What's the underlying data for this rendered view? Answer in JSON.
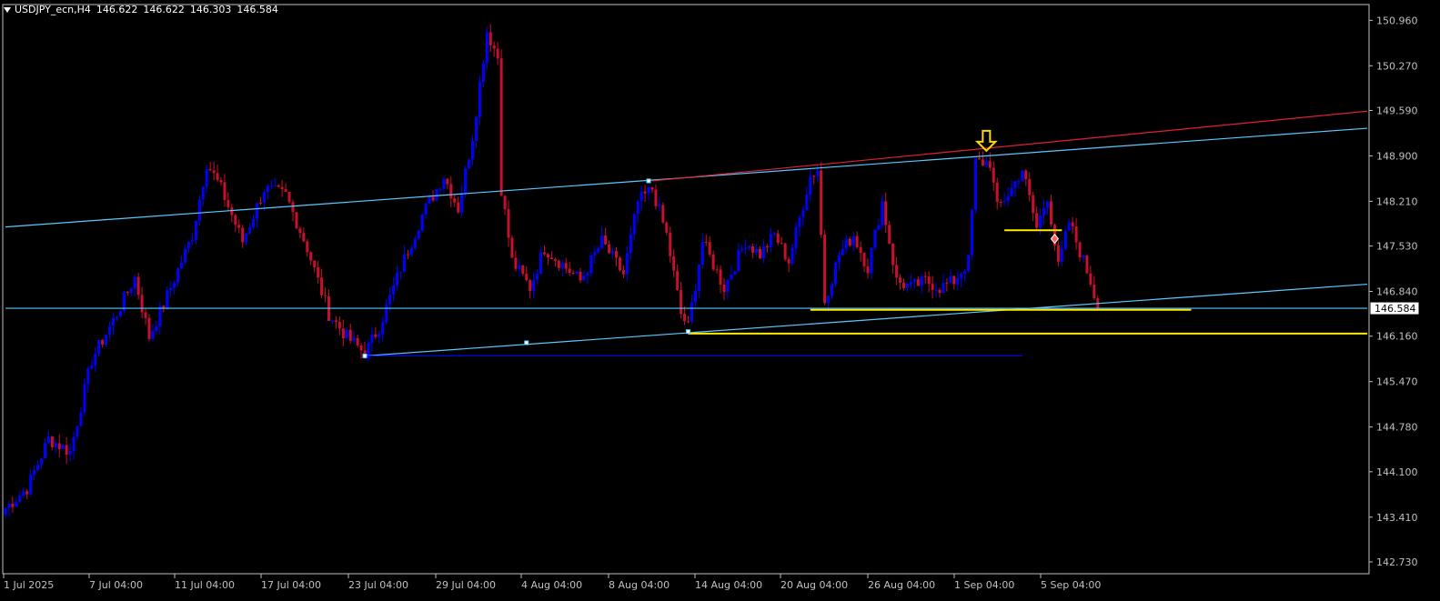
{
  "header": {
    "symbol": "USDJPY_ecn,H4",
    "open": "146.622",
    "high": "146.622",
    "low": "146.303",
    "close": "146.584"
  },
  "colors": {
    "background": "#000000",
    "axis": "#c0c0c0",
    "bull_candle": "#0000ff",
    "bear_candle": "#c8102e",
    "trendline_cyan": "#5bc8ff",
    "trendline_red": "#e0203a",
    "support_yellow": "#ffea00",
    "support_blue": "#0000ff",
    "arrow": "#ffd700"
  },
  "chart_data": {
    "type": "candlestick",
    "timeframe": "H4",
    "ylim": [
      142.55,
      151.2
    ],
    "yticks": [
      "150.960",
      "150.270",
      "149.590",
      "148.900",
      "148.210",
      "147.530",
      "146.840",
      "146.160",
      "145.470",
      "144.780",
      "144.100",
      "143.410",
      "142.730"
    ],
    "xticks": [
      "1 Jul 2025",
      "7 Jul 04:00",
      "11 Jul 04:00",
      "17 Jul 04:00",
      "23 Jul 04:00",
      "29 Jul 04:00",
      "4 Aug 04:00",
      "8 Aug 04:00",
      "14 Aug 04:00",
      "20 Aug 04:00",
      "26 Aug 04:00",
      "1 Sep 04:00",
      "5 Sep 04:00"
    ],
    "current_price": "146.584",
    "anchors": [
      {
        "bar": 0,
        "close": 143.55
      },
      {
        "bar": 6,
        "close": 143.85
      },
      {
        "bar": 12,
        "close": 144.6
      },
      {
        "bar": 18,
        "close": 144.4
      },
      {
        "bar": 24,
        "close": 145.8
      },
      {
        "bar": 30,
        "close": 146.4
      },
      {
        "bar": 36,
        "close": 147.05
      },
      {
        "bar": 40,
        "close": 146.15
      },
      {
        "bar": 46,
        "close": 146.9
      },
      {
        "bar": 52,
        "close": 147.7
      },
      {
        "bar": 56,
        "close": 148.8
      },
      {
        "bar": 60,
        "close": 148.4
      },
      {
        "bar": 66,
        "close": 147.6
      },
      {
        "bar": 72,
        "close": 148.4
      },
      {
        "bar": 78,
        "close": 148.3
      },
      {
        "bar": 84,
        "close": 147.5
      },
      {
        "bar": 90,
        "close": 146.5
      },
      {
        "bar": 95,
        "close": 146.15
      },
      {
        "bar": 100,
        "close": 145.9
      },
      {
        "bar": 104,
        "close": 146.3
      },
      {
        "bar": 110,
        "close": 147.2
      },
      {
        "bar": 116,
        "close": 148.0
      },
      {
        "bar": 122,
        "close": 148.6
      },
      {
        "bar": 126,
        "close": 148.1
      },
      {
        "bar": 130,
        "close": 149.2
      },
      {
        "bar": 134,
        "close": 150.8
      },
      {
        "bar": 137,
        "close": 150.4
      },
      {
        "bar": 138,
        "close": 148.4
      },
      {
        "bar": 141,
        "close": 147.3
      },
      {
        "bar": 146,
        "close": 146.9
      },
      {
        "bar": 150,
        "close": 147.5
      },
      {
        "bar": 156,
        "close": 147.2
      },
      {
        "bar": 160,
        "close": 147.0
      },
      {
        "bar": 166,
        "close": 147.6
      },
      {
        "bar": 172,
        "close": 147.1
      },
      {
        "bar": 176,
        "close": 148.2
      },
      {
        "bar": 180,
        "close": 148.4
      },
      {
        "bar": 184,
        "close": 147.7
      },
      {
        "bar": 188,
        "close": 146.5
      },
      {
        "bar": 190,
        "close": 146.3
      },
      {
        "bar": 194,
        "close": 147.6
      },
      {
        "bar": 200,
        "close": 146.9
      },
      {
        "bar": 206,
        "close": 147.6
      },
      {
        "bar": 210,
        "close": 147.4
      },
      {
        "bar": 214,
        "close": 147.7
      },
      {
        "bar": 218,
        "close": 147.3
      },
      {
        "bar": 224,
        "close": 148.6
      },
      {
        "bar": 226,
        "close": 148.7
      },
      {
        "bar": 228,
        "close": 146.7
      },
      {
        "bar": 232,
        "close": 147.4
      },
      {
        "bar": 236,
        "close": 147.7
      },
      {
        "bar": 240,
        "close": 147.2
      },
      {
        "bar": 244,
        "close": 148.2
      },
      {
        "bar": 248,
        "close": 147.0
      },
      {
        "bar": 252,
        "close": 146.9
      },
      {
        "bar": 256,
        "close": 147.0
      },
      {
        "bar": 260,
        "close": 146.9
      },
      {
        "bar": 264,
        "close": 147.0
      },
      {
        "bar": 268,
        "close": 147.3
      },
      {
        "bar": 270,
        "close": 148.8
      },
      {
        "bar": 274,
        "close": 148.8
      },
      {
        "bar": 276,
        "close": 148.1
      },
      {
        "bar": 280,
        "close": 148.4
      },
      {
        "bar": 283,
        "close": 148.7
      },
      {
        "bar": 287,
        "close": 147.8
      },
      {
        "bar": 290,
        "close": 148.3
      },
      {
        "bar": 293,
        "close": 147.2
      },
      {
        "bar": 296,
        "close": 147.9
      },
      {
        "bar": 298,
        "close": 147.6
      },
      {
        "bar": 302,
        "close": 147.0
      },
      {
        "bar": 304,
        "close": 146.584
      }
    ],
    "lines": [
      {
        "name": "upper channel",
        "color": "cyan",
        "points": [
          [
            0,
            147.82
          ],
          [
            379,
            149.32
          ]
        ]
      },
      {
        "name": "resistance",
        "color": "red",
        "points": [
          [
            180,
            148.52
          ],
          [
            379,
            149.58
          ]
        ]
      },
      {
        "name": "lower channel",
        "color": "cyan",
        "points": [
          [
            100,
            145.86
          ],
          [
            379,
            146.95
          ]
        ]
      },
      {
        "name": "support 1",
        "color": "yellow",
        "points": [
          [
            224,
            146.56
          ],
          [
            330,
            146.56
          ]
        ]
      },
      {
        "name": "support 2",
        "color": "yellow",
        "points": [
          [
            190,
            146.2
          ],
          [
            379,
            146.2
          ]
        ]
      },
      {
        "name": "base",
        "color": "blue",
        "points": [
          [
            100,
            145.86
          ],
          [
            283,
            145.86
          ]
        ]
      },
      {
        "name": "short level",
        "color": "yellow",
        "points": [
          [
            278,
            147.77
          ],
          [
            294,
            147.77
          ]
        ]
      },
      {
        "name": "current price",
        "color": "cyan",
        "points": [
          [
            0,
            146.584
          ],
          [
            379,
            146.584
          ]
        ]
      }
    ],
    "markers": [
      {
        "type": "arrow-down",
        "bar": 273,
        "price": 148.95
      },
      {
        "type": "diamond",
        "bar": 292,
        "price": 147.64
      },
      {
        "type": "pivot",
        "bar": 100,
        "price": 145.86
      },
      {
        "type": "pivot",
        "bar": 145,
        "price": 146.06
      },
      {
        "type": "pivot",
        "bar": 190,
        "price": 146.23
      },
      {
        "type": "pivot",
        "bar": 179,
        "price": 148.52
      }
    ]
  }
}
